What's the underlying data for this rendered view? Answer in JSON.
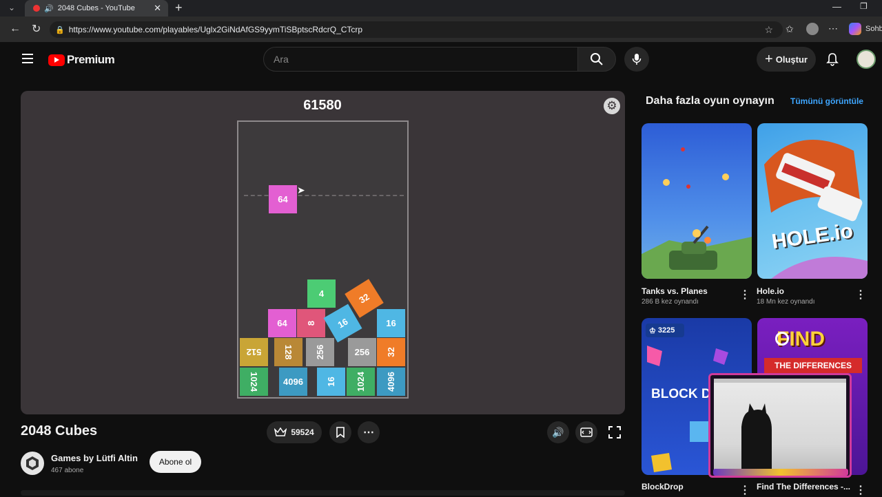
{
  "browser": {
    "tab_title": "2048 Cubes - YouTube",
    "url": "https://www.youtube.com/playables/Uglx2GiNdAfGS9yymTiSBptscRdcrQ_CTcrp",
    "profile_label": "Sohb"
  },
  "header": {
    "logo_text": "Premium",
    "search_placeholder": "Ara",
    "create_label": "Oluştur"
  },
  "game": {
    "score": "61580",
    "falling_cube": {
      "value": "64",
      "color": "#e35fd2"
    },
    "cubes": [
      {
        "value": "4",
        "color": "#4ccc74"
      },
      {
        "value": "32",
        "color": "#f07c28"
      },
      {
        "value": "64",
        "color": "#e35fd2"
      },
      {
        "value": "8",
        "color": "#e0567a"
      },
      {
        "value": "16",
        "color": "#4fb7e4"
      },
      {
        "value": "16",
        "color": "#4fb7e4"
      },
      {
        "value": "512",
        "color": "#c9a536"
      },
      {
        "value": "128",
        "color": "#b98836"
      },
      {
        "value": "256",
        "color": "#9a9a9a"
      },
      {
        "value": "256",
        "color": "#9a9a9a"
      },
      {
        "value": "32",
        "color": "#f07c28"
      },
      {
        "value": "1024",
        "color": "#3fae64"
      },
      {
        "value": "4096",
        "color": "#3d9ac2"
      },
      {
        "value": "16",
        "color": "#4fb7e4"
      },
      {
        "value": "1024",
        "color": "#3fae64"
      },
      {
        "value": "4096",
        "color": "#3d9ac2"
      }
    ]
  },
  "video": {
    "title": "2048 Cubes",
    "crown_count": "59524",
    "channel_name": "Games by Lütfi Altin",
    "subscribers": "467 abone",
    "subscribe_label": "Abone ol"
  },
  "sidebar": {
    "heading": "Daha fazla oyun oynayın",
    "see_all": "Tümünü görüntüle",
    "games": [
      {
        "title": "Tanks vs. Planes",
        "plays": "286 B kez oynandı"
      },
      {
        "title": "Hole.io",
        "plays": "18 Mn kez oynandı"
      },
      {
        "title": "BlockDrop",
        "plays": "",
        "badge": "3225",
        "thumb_text": "BLOCK D"
      },
      {
        "title": "Find The Differences -...",
        "plays": "",
        "thumb_text_1": "FIND",
        "thumb_text_2": "THE DIFFERENCES"
      }
    ],
    "hole_logo": "HOLE.io"
  }
}
